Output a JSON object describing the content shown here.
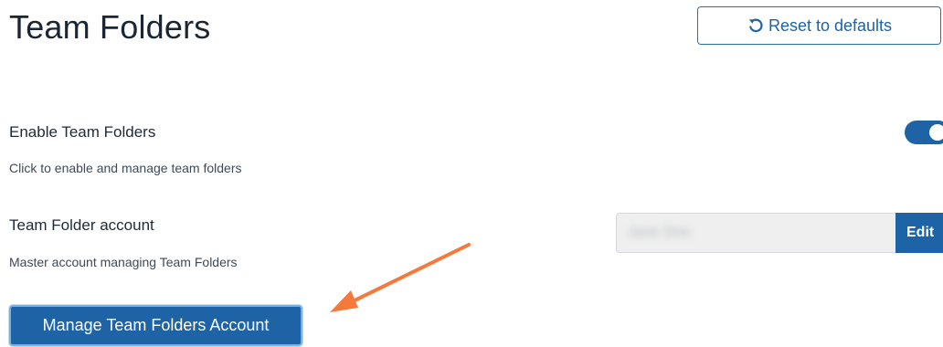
{
  "header": {
    "title": "Team Folders",
    "reset_label": "Reset to defaults"
  },
  "settings": {
    "enable": {
      "label": "Enable Team Folders",
      "description": "Click to enable and manage team folders",
      "enabled": true
    },
    "account": {
      "label": "Team Folder account",
      "description": "Master account managing Team Folders",
      "value": "Jane Doe",
      "edit_label": "Edit"
    }
  },
  "actions": {
    "manage_label": "Manage Team Folders Account"
  },
  "colors": {
    "accent": "#1d63a5",
    "annotation": "#f4793b"
  }
}
